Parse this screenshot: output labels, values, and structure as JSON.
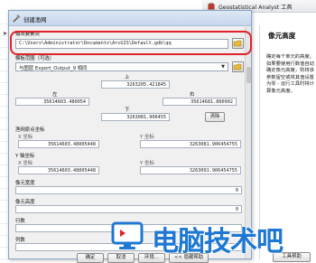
{
  "top_toolbar": {
    "label": "Geostatistical Analyst 工具"
  },
  "dialog": {
    "title": "创建渔网",
    "output_label": "输出要素类",
    "output_path": "C:\\Users\\Administrator\\Documents\\ArcGIS\\Default.gdb\\qq",
    "template_label": "模板范围（可选）",
    "template_value": "与图层 Export_Output_9 相同",
    "top_label": "上",
    "top_value": "3263205.421845",
    "left_label": "左",
    "left_value": "35614603.480054",
    "right_label": "右",
    "right_value": "35614681.800902",
    "bottom_label": "下",
    "bottom_value": "3263081.906455",
    "clear_label": "清除",
    "origin_label": "渔网原点坐标",
    "origin_x_label": "X 坐标",
    "origin_x_value": "35614603.48005448",
    "origin_y_label": "Y 坐标",
    "origin_y_value": "3263081.906454755",
    "yaxis_label": "Y 轴坐标",
    "yaxis_x_label": "X 坐标",
    "yaxis_x_value": "35614603.48005448",
    "yaxis_y_label": "Y 坐标",
    "yaxis_y_value": "3263091.906454755",
    "cell_width_label": "像元宽度",
    "cell_width_value": "0",
    "cell_height_label": "像元高度",
    "cell_height_value": "0",
    "rows_label": "行数",
    "cols_label": "列数",
    "buttons": {
      "ok": "确定",
      "cancel": "取消",
      "env": "环境...",
      "hide_help": "<< 隐藏帮助",
      "tool_help": "工具帮助"
    }
  },
  "help_panel": {
    "heading": "像元高度",
    "description": "确定每个单元的高度。如果要使用行数值自动确定像元高度，则将该参数留空或将其值设置为零 - 运行工具时将计算像元高度。"
  },
  "watermark": {
    "text": "电脑技术吧"
  }
}
